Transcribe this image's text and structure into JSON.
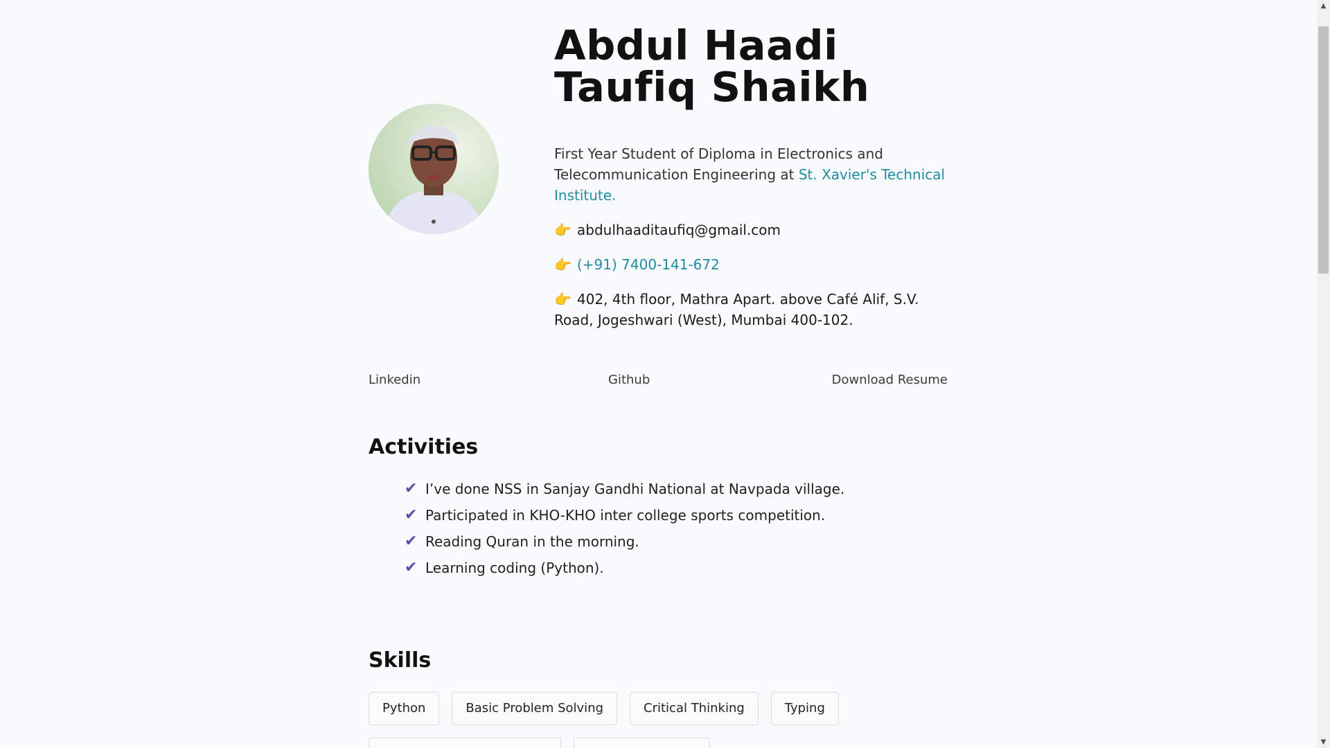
{
  "header": {
    "name_line1": "Abdul Haadi",
    "name_line2": "Taufiq Shaikh",
    "bio_text": "First Year Student of Diploma in Electronics and Telecommunication Engineering at ",
    "bio_link": "St. Xavier's Technical Institute.",
    "email": "abdulhaaditaufiq@gmail.com",
    "phone": "(+91) 7400-141-672",
    "address": "402, 4th floor, Mathra Apart. above Café Alif, S.V. Road, Jogeshwari (West), Mumbai 400-102.",
    "pointer_icon": "👉"
  },
  "links": {
    "linkedin": "Linkedin",
    "github": "Github",
    "resume": "Download Resume"
  },
  "activities": {
    "title": "Activities",
    "check_icon": "✔",
    "items": [
      "I’ve done NSS in Sanjay Gandhi National at Navpada village.",
      "Participated in KHO-KHO inter college sports competition.",
      "Reading Quran in the morning.",
      "Learning coding (Python)."
    ]
  },
  "skills": {
    "title": "Skills",
    "items": [
      "Python",
      "Basic Problem Solving",
      "Critical Thinking",
      "Typing"
    ]
  },
  "scrollbar": {
    "up_icon": "▲",
    "down_icon": "▼"
  }
}
